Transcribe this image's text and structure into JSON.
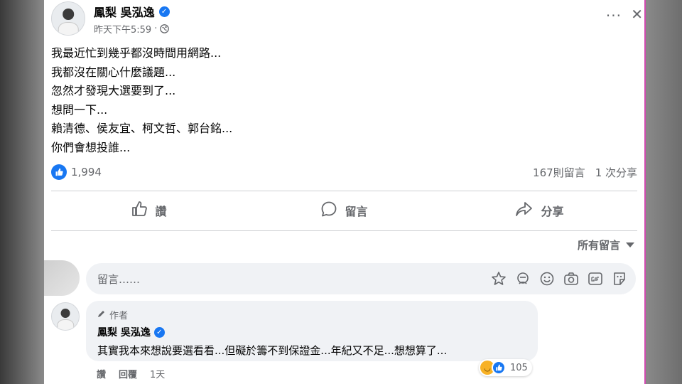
{
  "post": {
    "author_name": "鳳梨 吳泓逸",
    "timestamp": "昨天下午5:59",
    "privacy_icon": "globe-icon",
    "lines": [
      "我最近忙到幾乎都沒時間用網路...",
      "我都沒在關心什麼議題...",
      "忽然才發現大選要到了...",
      "想問一下...",
      "賴清德、侯友宜、柯文哲、郭台銘...",
      "你們會想投誰..."
    ],
    "more_label": "···",
    "close_label": "✕"
  },
  "stats": {
    "reactions_count": "1,994",
    "comments_count": "167則留言",
    "shares_count": "1 次分享"
  },
  "actions": {
    "like_label": "讚",
    "comment_label": "留言",
    "share_label": "分享"
  },
  "comments_section": {
    "sort_label": "所有留言",
    "input_placeholder": "留言……"
  },
  "comment": {
    "author_tag": "作者",
    "name": "鳳梨 吳泓逸",
    "text": "其實我本來想說要選看看...但礙於籌不到保證金...年紀又不足...想想算了...",
    "reaction_count": "105",
    "like_label": "讚",
    "reply_label": "回覆",
    "time": "1天"
  },
  "colors": {
    "accent": "#1877f2",
    "secondary_text": "#65676b",
    "input_bg": "#f0f2f5"
  }
}
